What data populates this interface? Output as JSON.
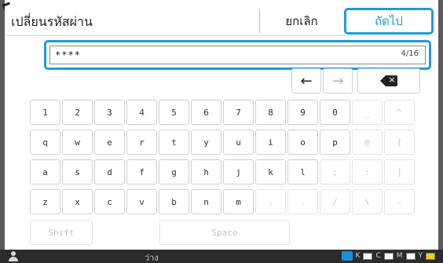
{
  "header": {
    "title": "เปลี่ยนรหัสผ่าน",
    "cancel_label": "ยกเลิก",
    "next_label": "ถัดไป"
  },
  "password": {
    "value": "****",
    "counter": "4/16"
  },
  "nav": {
    "left_arrow": "←",
    "right_arrow": "→"
  },
  "keyboard": {
    "rows": [
      [
        "1",
        "2",
        "3",
        "4",
        "5",
        "6",
        "7",
        "8",
        "9",
        "0",
        "_",
        "^"
      ],
      [
        "q",
        "w",
        "e",
        "r",
        "t",
        "y",
        "u",
        "i",
        "o",
        "p",
        "@",
        "["
      ],
      [
        "a",
        "s",
        "d",
        "f",
        "g",
        "h",
        "j",
        "k",
        "l",
        ";",
        ":",
        "]"
      ],
      [
        "z",
        "x",
        "c",
        "v",
        "b",
        "n",
        "m",
        ",",
        ".",
        "/",
        "\\",
        "-"
      ]
    ],
    "disabled_from_col": [
      10,
      10,
      9,
      7
    ],
    "shift_label": "Shift",
    "space_label": "Space"
  },
  "status_bar": {
    "text": "ว่าง",
    "ink_labels": [
      "K",
      "C",
      "M",
      "Y"
    ]
  },
  "colors": {
    "accent": "#1f9bd8",
    "status_bar": "#2b2b2b",
    "disabled_text": "#c6c6c6"
  }
}
